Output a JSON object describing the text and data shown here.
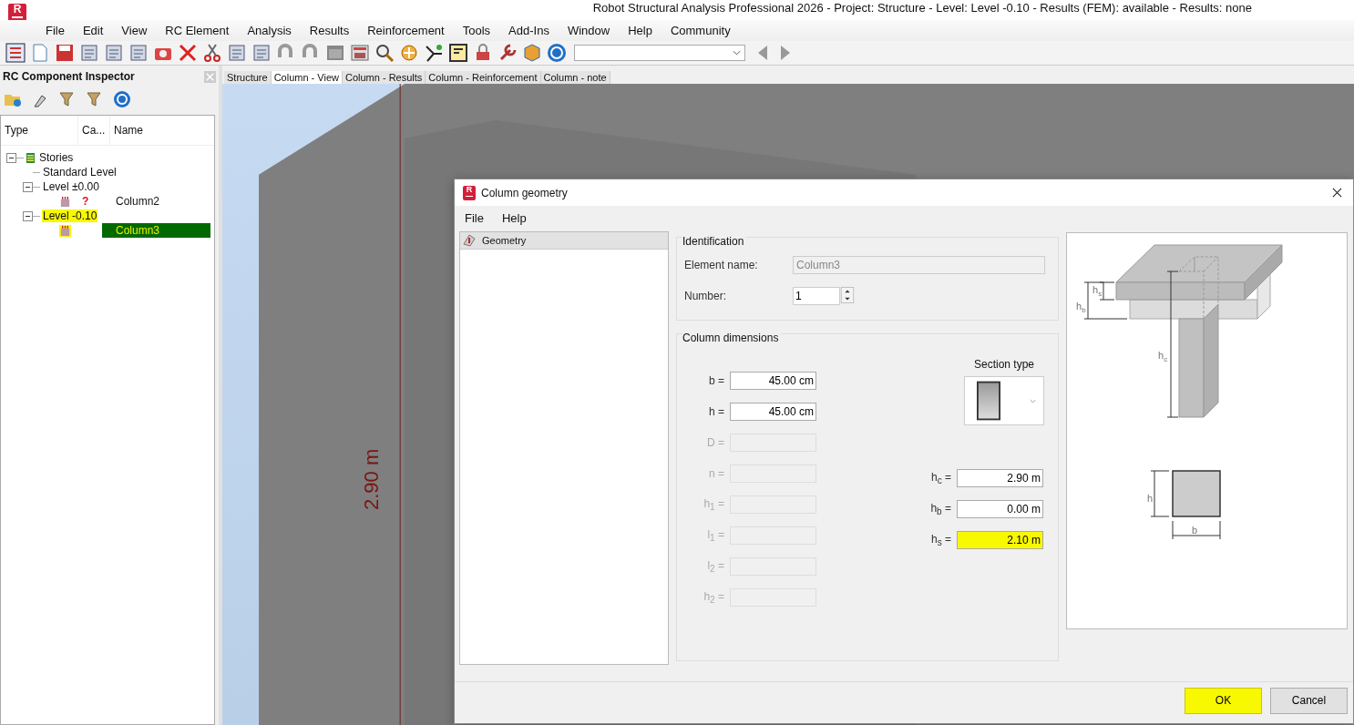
{
  "app": {
    "logo": {
      "letter": "R"
    },
    "title": "Robot Structural Analysis Professional 2026 - Project: Structure - Level: Level -0.10 - Results (FEM): available - Results: none"
  },
  "menu": [
    "File",
    "Edit",
    "View",
    "RC Element",
    "Analysis",
    "Results",
    "Reinforcement",
    "Tools",
    "Add-Ins",
    "Window",
    "Help",
    "Community"
  ],
  "inspector": {
    "title": "RC Component Inspector",
    "columns": [
      "Type",
      "Ca...",
      "Name"
    ],
    "tree": [
      {
        "label": "Stories",
        "kind": "group",
        "expanded": true,
        "children": [
          {
            "label": "Standard Level",
            "kind": "level",
            "highlighted": false
          },
          {
            "label": "Level ±0.00",
            "kind": "level",
            "expanded": true,
            "highlighted": false,
            "children": [
              {
                "kind": "column",
                "category": "?",
                "name": "Column2",
                "selected": false,
                "highlighted": false
              }
            ]
          },
          {
            "label": "Level -0.10",
            "kind": "level",
            "expanded": true,
            "highlighted": true,
            "children": [
              {
                "kind": "column",
                "name": "Column3",
                "selected": true,
                "highlighted": true
              }
            ]
          }
        ]
      }
    ]
  },
  "tabs": [
    {
      "label": "Structure",
      "selected": false
    },
    {
      "label": "Column - View",
      "selected": true
    },
    {
      "label": "Column - Results",
      "selected": false
    },
    {
      "label": "Column - Reinforcement",
      "selected": false
    },
    {
      "label": "Column - note",
      "selected": false
    }
  ],
  "viewport": {
    "dimension": "2.90 m"
  },
  "dialog": {
    "logo": {
      "letter": "R"
    },
    "title": "Column geometry",
    "menu": [
      "File",
      "Help"
    ],
    "pages": [
      {
        "label": "Geometry",
        "selected": true
      }
    ],
    "identification": {
      "title": "Identification",
      "element_name": {
        "label": "Element name:",
        "value": "Column3",
        "disabled": true
      },
      "number": {
        "label": "Number:",
        "value": "1"
      }
    },
    "dimensions": {
      "title": "Column dimensions",
      "fields": [
        {
          "label": "b =",
          "value": "45.00 cm",
          "disabled": false
        },
        {
          "label": "h =",
          "value": "45.00 cm",
          "disabled": false
        },
        {
          "label": "D =",
          "disabled": true
        },
        {
          "label": "n =",
          "disabled": true
        },
        {
          "label": "h$_{1}$ =",
          "disabled": true
        },
        {
          "label": "l$_{1}$ =",
          "disabled": true
        },
        {
          "label": "l$_{2}$ =",
          "disabled": true
        },
        {
          "label": "h$_{2}$ =",
          "disabled": true
        }
      ],
      "section_type": {
        "label": "Section type"
      },
      "height_fields": [
        {
          "label": "h$_{c}$ =",
          "value": "2.90 m",
          "highlighted": false
        },
        {
          "label": "h$_{b}$ =",
          "value": "0.00 m",
          "highlighted": false
        },
        {
          "label": "h$_{s}$ =",
          "value": "2.10 m",
          "highlighted": true
        }
      ]
    },
    "diagram_labels": {
      "hs": {
        "text": "h",
        "sub": "s"
      },
      "hb": {
        "text": "h",
        "sub": "b"
      },
      "hc": {
        "text": "h",
        "sub": "c"
      },
      "h": {
        "text": "h"
      },
      "b": {
        "text": "b"
      }
    },
    "buttons": [
      {
        "label": "OK",
        "highlighted": true
      },
      {
        "label": "Cancel",
        "highlighted": false
      }
    ]
  }
}
